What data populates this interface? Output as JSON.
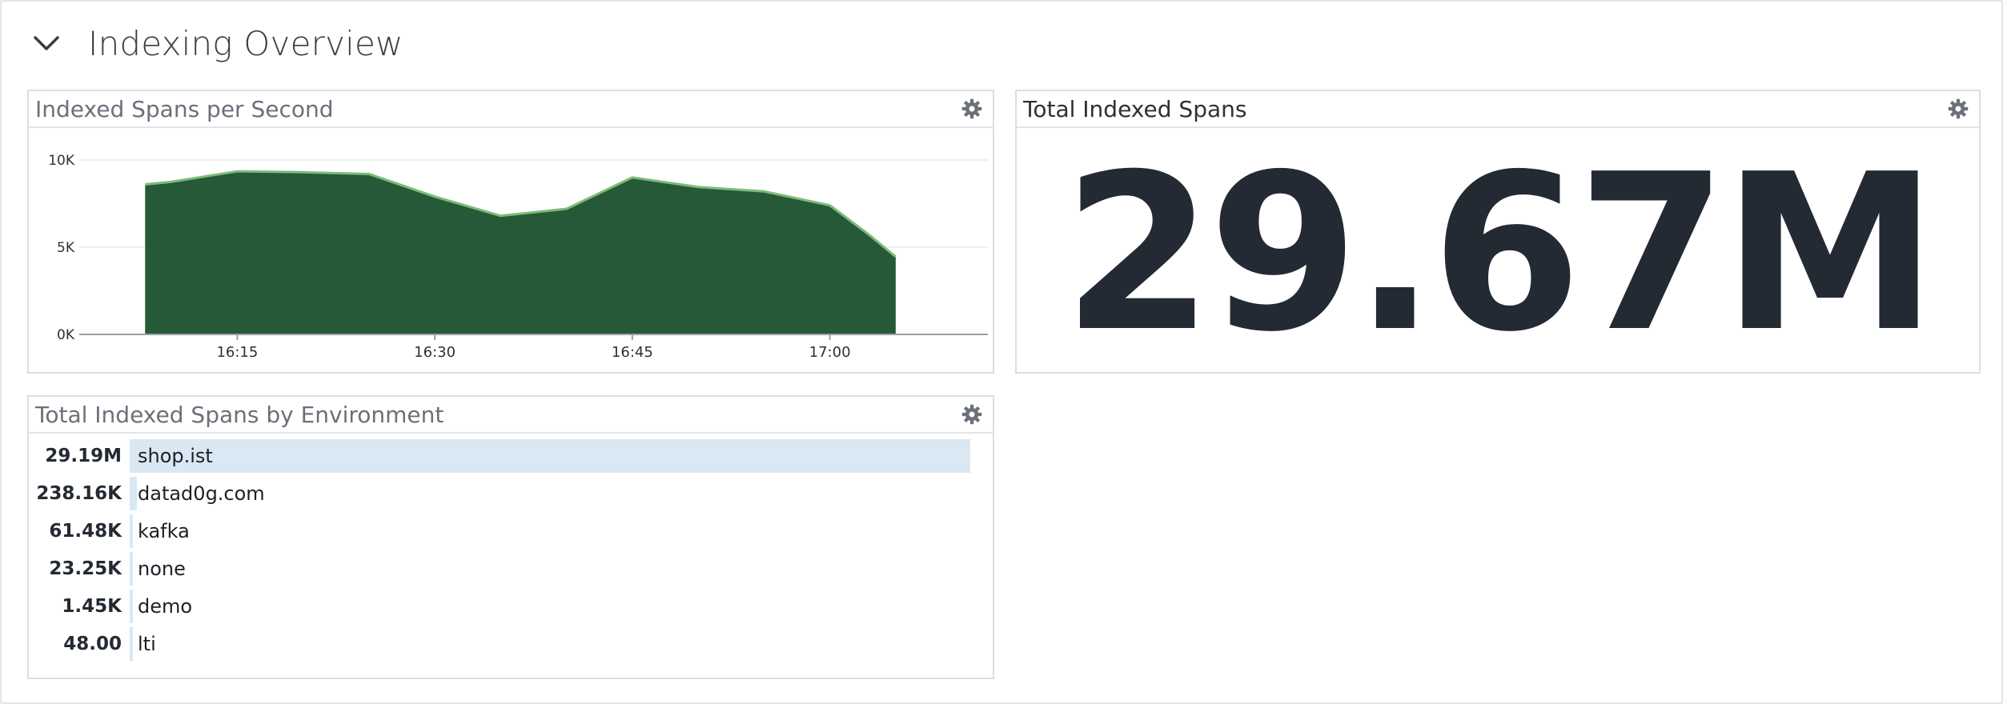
{
  "section": {
    "title": "Indexing Overview",
    "icon": "chevron-down-icon"
  },
  "widgets": {
    "spans_per_second": {
      "title": "Indexed Spans per Second",
      "settings_icon": "gear-icon"
    },
    "total_indexed": {
      "title": "Total Indexed Spans",
      "value": "29.67M",
      "settings_icon": "gear-icon"
    },
    "by_environment": {
      "title": "Total Indexed Spans by Environment",
      "settings_icon": "gear-icon",
      "rows": [
        {
          "value": "29.19M",
          "label": "shop.ist",
          "fraction": 1.0
        },
        {
          "value": "238.16K",
          "label": "datad0g.com",
          "fraction": 0.00816
        },
        {
          "value": "61.48K",
          "label": "kafka",
          "fraction": 0.0021
        },
        {
          "value": "23.25K",
          "label": "none",
          "fraction": 0.0008
        },
        {
          "value": "1.45K",
          "label": "demo",
          "fraction": 5e-05
        },
        {
          "value": "48.00",
          "label": "lti",
          "fraction": 1.6e-06
        }
      ]
    }
  },
  "chart_data": {
    "type": "area",
    "title": "Indexed Spans per Second",
    "x_ticks": [
      "16:15",
      "16:30",
      "16:45",
      "17:00"
    ],
    "y_ticks": [
      "0K",
      "5K",
      "10K"
    ],
    "ylim": [
      0,
      10000
    ],
    "grid": true,
    "fill_color": "#265937",
    "line_color": "#7dbb77",
    "x": [
      "16:08",
      "16:10",
      "16:15",
      "16:20",
      "16:25",
      "16:30",
      "16:35",
      "16:40",
      "16:45",
      "16:50",
      "16:55",
      "17:00",
      "17:03",
      "17:05"
    ],
    "values": [
      8600,
      8750,
      9350,
      9300,
      9200,
      7900,
      6800,
      7200,
      9000,
      8450,
      8200,
      7400,
      5700,
      4450
    ]
  }
}
